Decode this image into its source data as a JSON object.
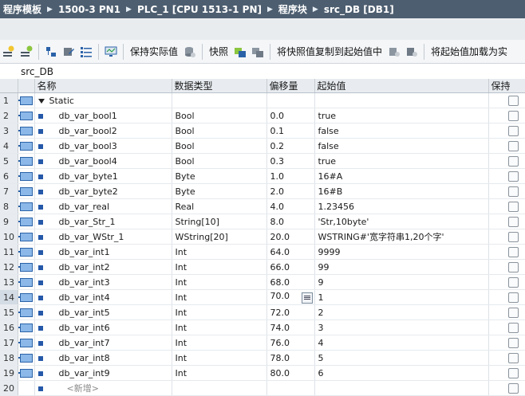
{
  "breadcrumb": {
    "items": [
      "程序模板",
      "1500-3 PN1",
      "PLC_1 [CPU 1513-1 PN]",
      "程序块",
      "src_DB [DB1]"
    ],
    "separator": "▶"
  },
  "toolbar": {
    "keep_actual_label": "保持实际值",
    "snapshot_label": "快照",
    "copy_snapshot_label": "将快照值复制到起始值中",
    "load_start_label": "将起始值加载为实"
  },
  "db_title": "src_DB",
  "table": {
    "headers": {
      "name": "名称",
      "datatype": "数据类型",
      "offset": "偏移量",
      "start": "起始值",
      "retain": "保持"
    },
    "rows": [
      {
        "num": "1",
        "name": "Static",
        "type": "",
        "offset": "",
        "start": ""
      },
      {
        "num": "2",
        "name": "db_var_bool1",
        "type": "Bool",
        "offset": "0.0",
        "start": "true"
      },
      {
        "num": "3",
        "name": "db_var_bool2",
        "type": "Bool",
        "offset": "0.1",
        "start": "false"
      },
      {
        "num": "4",
        "name": "db_var_bool3",
        "type": "Bool",
        "offset": "0.2",
        "start": "false"
      },
      {
        "num": "5",
        "name": "db_var_bool4",
        "type": "Bool",
        "offset": "0.3",
        "start": "true"
      },
      {
        "num": "6",
        "name": "db_var_byte1",
        "type": "Byte",
        "offset": "1.0",
        "start": "16#A"
      },
      {
        "num": "7",
        "name": "db_var_byte2",
        "type": "Byte",
        "offset": "2.0",
        "start": "16#B"
      },
      {
        "num": "8",
        "name": "db_var_real",
        "type": "Real",
        "offset": "4.0",
        "start": "1.23456"
      },
      {
        "num": "9",
        "name": "db_var_Str_1",
        "type": "String[10]",
        "offset": "8.0",
        "start": "'Str,10byte'"
      },
      {
        "num": "10",
        "name": "db_var_WStr_1",
        "type": "WString[20]",
        "offset": "20.0",
        "start": "WSTRING#'宽字符串1,20个字'"
      },
      {
        "num": "11",
        "name": "db_var_int1",
        "type": "Int",
        "offset": "64.0",
        "start": "9999"
      },
      {
        "num": "12",
        "name": "db_var_int2",
        "type": "Int",
        "offset": "66.0",
        "start": "99"
      },
      {
        "num": "13",
        "name": "db_var_int3",
        "type": "Int",
        "offset": "68.0",
        "start": "9"
      },
      {
        "num": "14",
        "name": "db_var_int4",
        "type": "Int",
        "offset": "70.0",
        "start": "1"
      },
      {
        "num": "15",
        "name": "db_var_int5",
        "type": "Int",
        "offset": "72.0",
        "start": "2"
      },
      {
        "num": "16",
        "name": "db_var_int6",
        "type": "Int",
        "offset": "74.0",
        "start": "3"
      },
      {
        "num": "17",
        "name": "db_var_int7",
        "type": "Int",
        "offset": "76.0",
        "start": "4"
      },
      {
        "num": "18",
        "name": "db_var_int8",
        "type": "Int",
        "offset": "78.0",
        "start": "5"
      },
      {
        "num": "19",
        "name": "db_var_int9",
        "type": "Int",
        "offset": "80.0",
        "start": "6"
      },
      {
        "num": "20",
        "name": "<新增>",
        "type": "",
        "offset": "",
        "start": ""
      }
    ]
  },
  "colors": {
    "title_bg": "#4d5e70",
    "header_bg": "#e8ecf0",
    "icon_blue": "#2a62a8"
  }
}
